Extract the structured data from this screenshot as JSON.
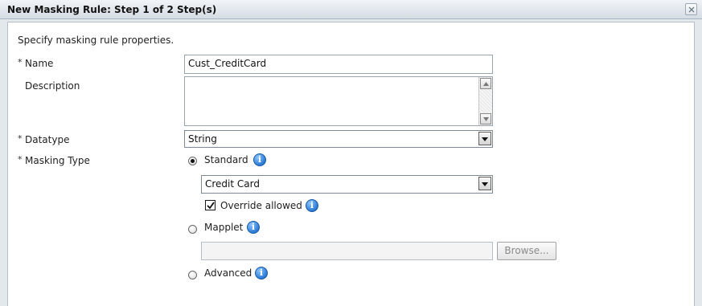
{
  "dialog": {
    "title": "New Masking Rule: Step 1 of 2 Step(s)",
    "instruction": "Specify masking rule properties."
  },
  "fields": {
    "required_marker": "*",
    "name": {
      "label": "Name",
      "value": "Cust_CreditCard"
    },
    "description": {
      "label": "Description",
      "value": ""
    },
    "datatype": {
      "label": "Datatype",
      "value": "String"
    },
    "masking_type": {
      "label": "Masking Type",
      "standard": {
        "label": "Standard",
        "checked": true,
        "selected_value": "Credit Card",
        "override_label": "Override allowed",
        "override_checked": true
      },
      "mapplet": {
        "label": "Mapplet",
        "checked": false,
        "value": "",
        "browse_label": "Browse..."
      },
      "advanced": {
        "label": "Advanced",
        "checked": false
      }
    }
  },
  "icons": {
    "info": "info-icon",
    "close": "close-icon",
    "dropdown": "chevron-down-icon",
    "check": "checkmark-icon"
  },
  "colors": {
    "info_icon": "#2a7ad6",
    "title_bar": "#d5dce3",
    "panel_bg": "#ffffff",
    "page_bg": "#e3e8ed"
  }
}
